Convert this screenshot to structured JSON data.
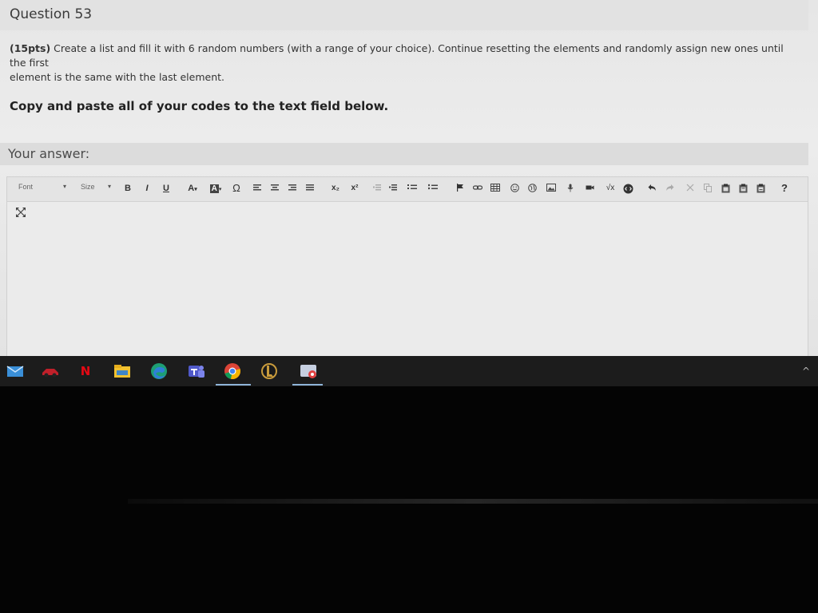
{
  "question": {
    "title": "Question 53",
    "points": "(15pts)",
    "body_line1": " Create a list and fill it with 6 random numbers (with a range of your choice). Continue resetting the elements and randomly assign new ones until the first",
    "body_line2": "element is the same with the last element.",
    "instruction": "Copy and paste all of your codes to the text field below."
  },
  "answer": {
    "label": "Your answer:"
  },
  "toolbar": {
    "font_label": "Font",
    "size_label": "Size",
    "bold": "B",
    "italic": "I",
    "underline": "U",
    "text_color": "A",
    "bg_color": "A",
    "special_char": "Ω",
    "subscript": "x₂",
    "superscript": "x²",
    "help": "?"
  },
  "taskbar": {
    "netflix_label": "N",
    "chevron": "^",
    "icons": [
      "mail-icon",
      "racing-game-icon",
      "netflix-icon",
      "file-explorer-icon",
      "edge-icon",
      "teams-icon",
      "chrome-icon",
      "league-of-legends-icon",
      "camera-app-icon"
    ]
  },
  "colors": {
    "screen_bg": "#e6e6e6",
    "taskbar_bg": "#1c1c1c",
    "chrome_active_underline": "#8fb4d8"
  }
}
